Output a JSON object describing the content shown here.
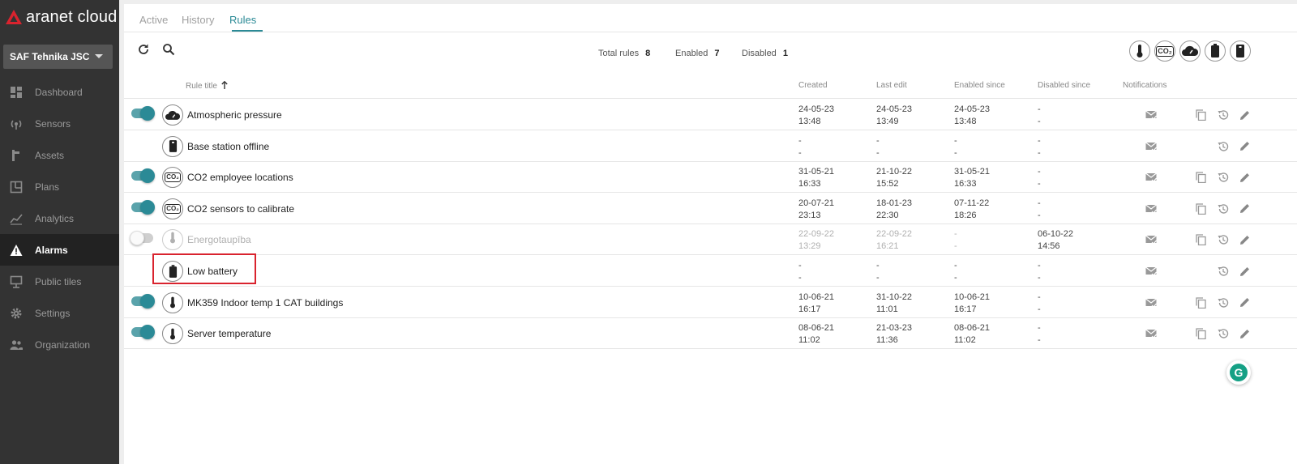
{
  "app": {
    "brand": "aranet cloud",
    "organization": "SAF Tehnika JSC",
    "accent": "#2b8a96"
  },
  "nav": [
    {
      "label": "Dashboard",
      "icon": "dashboard-icon"
    },
    {
      "label": "Sensors",
      "icon": "sensors-icon"
    },
    {
      "label": "Assets",
      "icon": "assets-icon"
    },
    {
      "label": "Plans",
      "icon": "plans-icon"
    },
    {
      "label": "Analytics",
      "icon": "analytics-icon"
    },
    {
      "label": "Alarms",
      "icon": "warning-icon",
      "active": true
    },
    {
      "label": "Public tiles",
      "icon": "public-tiles-icon"
    },
    {
      "label": "Settings",
      "icon": "gear-icon"
    },
    {
      "label": "Organization",
      "icon": "people-icon"
    }
  ],
  "tabs": {
    "active": "Active",
    "history": "History",
    "rules": "Rules"
  },
  "stats": {
    "total_label": "Total rules",
    "total": "8",
    "enabled_label": "Enabled",
    "enabled": "7",
    "disabled_label": "Disabled",
    "disabled": "1"
  },
  "columns": {
    "rule_title": "Rule title",
    "created": "Created",
    "last_edit": "Last edit",
    "enabled_since": "Enabled since",
    "disabled_since": "Disabled since",
    "notifications": "Notifications"
  },
  "filter_labels": {
    "co2": "CO₂"
  },
  "rules": [
    {
      "title": "Atmospheric pressure",
      "type": "pressure-icon",
      "toggle": "on",
      "created": [
        "24-05-23",
        "13:48"
      ],
      "last_edit": [
        "24-05-23",
        "13:49"
      ],
      "enabled_since": [
        "24-05-23",
        "13:48"
      ],
      "disabled_since": [
        "-",
        "-"
      ],
      "copy": true
    },
    {
      "title": "Base station offline",
      "type": "base-station-icon",
      "toggle": "none",
      "created": [
        "-",
        "-"
      ],
      "last_edit": [
        "-",
        "-"
      ],
      "enabled_since": [
        "-",
        "-"
      ],
      "disabled_since": [
        "-",
        "-"
      ],
      "copy": false
    },
    {
      "title": "CO2 employee locations",
      "type": "co2-icon",
      "toggle": "on",
      "created": [
        "31-05-21",
        "16:33"
      ],
      "last_edit": [
        "21-10-22",
        "15:52"
      ],
      "enabled_since": [
        "31-05-21",
        "16:33"
      ],
      "disabled_since": [
        "-",
        "-"
      ],
      "copy": true
    },
    {
      "title": "CO2 sensors to calibrate",
      "type": "co2-icon",
      "toggle": "on",
      "created": [
        "20-07-21",
        "23:13"
      ],
      "last_edit": [
        "18-01-23",
        "22:30"
      ],
      "enabled_since": [
        "07-11-22",
        "18:26"
      ],
      "disabled_since": [
        "-",
        "-"
      ],
      "copy": true
    },
    {
      "title": "Energotaupība",
      "type": "thermometer-icon",
      "toggle": "off",
      "created": [
        "22-09-22",
        "13:29"
      ],
      "last_edit": [
        "22-09-22",
        "16:21"
      ],
      "enabled_since": [
        "-",
        "-"
      ],
      "disabled_since": [
        "06-10-22",
        "14:56"
      ],
      "copy": true
    },
    {
      "title": "Low battery",
      "type": "battery-icon",
      "toggle": "none",
      "created": [
        "-",
        "-"
      ],
      "last_edit": [
        "-",
        "-"
      ],
      "enabled_since": [
        "-",
        "-"
      ],
      "disabled_since": [
        "-",
        "-"
      ],
      "copy": false
    },
    {
      "title": "MK359 Indoor temp 1 CAT buildings",
      "type": "thermometer-icon",
      "toggle": "on",
      "created": [
        "10-06-21",
        "16:17"
      ],
      "last_edit": [
        "31-10-22",
        "11:01"
      ],
      "enabled_since": [
        "10-06-21",
        "16:17"
      ],
      "disabled_since": [
        "-",
        "-"
      ],
      "copy": true
    },
    {
      "title": "Server temperature",
      "type": "thermometer-icon",
      "toggle": "on",
      "created": [
        "08-06-21",
        "11:02"
      ],
      "last_edit": [
        "21-03-23",
        "11:36"
      ],
      "enabled_since": [
        "08-06-21",
        "11:02"
      ],
      "disabled_since": [
        "-",
        "-"
      ],
      "copy": true
    }
  ],
  "grammarly": "G"
}
